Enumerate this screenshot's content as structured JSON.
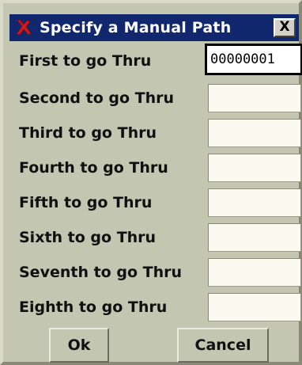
{
  "window": {
    "title": "Specify a Manual Path",
    "close_label": "X"
  },
  "fields": [
    {
      "label": "First to go Thru",
      "value": "00000001"
    },
    {
      "label": "Second to go Thru",
      "value": ""
    },
    {
      "label": "Third to go Thru",
      "value": ""
    },
    {
      "label": "Fourth to go Thru",
      "value": ""
    },
    {
      "label": "Fifth to go Thru",
      "value": ""
    },
    {
      "label": "Sixth to go Thru",
      "value": ""
    },
    {
      "label": "Seventh to go Thru",
      "value": ""
    },
    {
      "label": "Eighth to go Thru",
      "value": ""
    }
  ],
  "buttons": {
    "ok_label": "Ok",
    "cancel_label": "Cancel"
  },
  "icons": {
    "app": "red-x-icon",
    "close": "close-icon"
  },
  "colors": {
    "titlebar": "#12286e",
    "window_bg": "#c3c7b2",
    "field_bg": "#fbfaf0",
    "app_icon": "#d21a1a"
  }
}
